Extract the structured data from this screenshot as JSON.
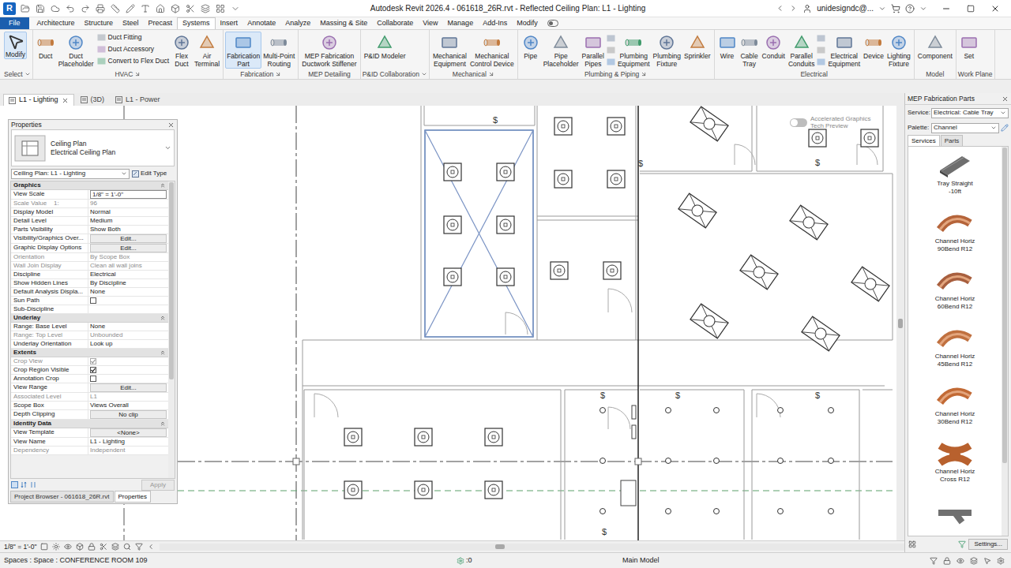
{
  "window": {
    "app_letter": "R",
    "title": "Autodesk Revit 2026.4 - 061618_26R.rvt - Reflected Ceiling Plan: L1 - Lighting",
    "user": "unidesigndc@..."
  },
  "menu_tabs": [
    {
      "label": "File",
      "kind": "app",
      "selected": false
    },
    {
      "label": "Architecture",
      "kind": "tab",
      "selected": false
    },
    {
      "label": "Structure",
      "kind": "tab",
      "selected": false
    },
    {
      "label": "Steel",
      "kind": "tab",
      "selected": false
    },
    {
      "label": "Precast",
      "kind": "tab",
      "selected": false
    },
    {
      "label": "Systems",
      "kind": "tab",
      "selected": true
    },
    {
      "label": "Insert",
      "kind": "tab",
      "selected": false
    },
    {
      "label": "Annotate",
      "kind": "tab",
      "selected": false
    },
    {
      "label": "Analyze",
      "kind": "tab",
      "selected": false
    },
    {
      "label": "Massing & Site",
      "kind": "tab",
      "selected": false
    },
    {
      "label": "Collaborate",
      "kind": "tab",
      "selected": false
    },
    {
      "label": "View",
      "kind": "tab",
      "selected": false
    },
    {
      "label": "Manage",
      "kind": "tab",
      "selected": false
    },
    {
      "label": "Add-Ins",
      "kind": "tab",
      "selected": false
    },
    {
      "label": "Modify",
      "kind": "tab",
      "selected": false
    }
  ],
  "ribbon": {
    "panels": [
      {
        "label": "Select",
        "menu": true,
        "launcher": false,
        "tools": [
          {
            "kind": "large",
            "lines": [
              "Modify"
            ],
            "active": true
          }
        ]
      },
      {
        "label": "HVAC",
        "menu": false,
        "launcher": true,
        "tools": [
          {
            "kind": "large",
            "lines": [
              "Duct"
            ],
            "active": false
          },
          {
            "kind": "large",
            "lines": [
              "Duct",
              "Placeholder"
            ],
            "active": false
          },
          {
            "kind": "stack",
            "items": [
              "Duct Fitting",
              "Duct Accessory",
              "Convert to Flex Duct"
            ]
          },
          {
            "kind": "large",
            "lines": [
              "Flex",
              "Duct"
            ],
            "active": false
          },
          {
            "kind": "large",
            "lines": [
              "Air",
              "Terminal"
            ],
            "active": false
          }
        ]
      },
      {
        "label": "Fabrication",
        "menu": false,
        "launcher": true,
        "tools": [
          {
            "kind": "large",
            "lines": [
              "Fabrication",
              "Part"
            ],
            "active": true
          },
          {
            "kind": "large",
            "lines": [
              "Multi-Point",
              "Routing"
            ],
            "active": false
          }
        ]
      },
      {
        "label": "MEP Detailing",
        "menu": false,
        "launcher": false,
        "tools": [
          {
            "kind": "large",
            "lines": [
              "MEP Fabrication",
              "Ductwork Stiffener"
            ],
            "active": false
          }
        ]
      },
      {
        "label": "P&ID Collaboration",
        "menu": true,
        "launcher": false,
        "tools": [
          {
            "kind": "large",
            "lines": [
              "P&ID Modeler"
            ],
            "active": false
          }
        ]
      },
      {
        "label": "Mechanical",
        "menu": false,
        "launcher": true,
        "tools": [
          {
            "kind": "large",
            "lines": [
              "Mechanical",
              "Equipment"
            ],
            "active": false
          },
          {
            "kind": "large",
            "lines": [
              "Mechanical",
              "Control Device"
            ],
            "active": false
          }
        ]
      },
      {
        "label": "Plumbing & Piping",
        "menu": false,
        "launcher": true,
        "tools": [
          {
            "kind": "large",
            "lines": [
              "Pipe"
            ],
            "active": false
          },
          {
            "kind": "large",
            "lines": [
              "Pipe",
              "Placeholder"
            ],
            "active": false
          },
          {
            "kind": "large",
            "lines": [
              "Parallel",
              "Pipes"
            ],
            "active": false
          },
          {
            "kind": "icons"
          },
          {
            "kind": "large",
            "lines": [
              "Plumbing",
              "Equipment"
            ],
            "active": false
          },
          {
            "kind": "large",
            "lines": [
              "Plumbing",
              "Fixture"
            ],
            "active": false
          },
          {
            "kind": "large",
            "lines": [
              "Sprinkler"
            ],
            "active": false
          }
        ]
      },
      {
        "label": "Electrical",
        "menu": false,
        "launcher": false,
        "tools": [
          {
            "kind": "large",
            "lines": [
              "Wire"
            ],
            "active": false
          },
          {
            "kind": "large",
            "lines": [
              "Cable",
              "Tray"
            ],
            "active": false
          },
          {
            "kind": "large",
            "lines": [
              "Conduit"
            ],
            "active": false
          },
          {
            "kind": "large",
            "lines": [
              "Parallel",
              "Conduits"
            ],
            "active": false
          },
          {
            "kind": "icons"
          },
          {
            "kind": "large",
            "lines": [
              "Electrical",
              "Equipment"
            ],
            "active": false
          },
          {
            "kind": "large",
            "lines": [
              "Device"
            ],
            "active": false
          },
          {
            "kind": "large",
            "lines": [
              "Lighting",
              "Fixture"
            ],
            "active": false
          }
        ]
      },
      {
        "label": "Model",
        "menu": false,
        "launcher": false,
        "tools": [
          {
            "kind": "large",
            "lines": [
              "Component"
            ],
            "active": false
          }
        ]
      },
      {
        "label": "Work Plane",
        "menu": false,
        "launcher": false,
        "tools": [
          {
            "kind": "large",
            "lines": [
              "Set"
            ],
            "active": false
          }
        ]
      }
    ]
  },
  "view_tabs": [
    {
      "label": "L1 - Lighting",
      "selected": true,
      "closable": true
    },
    {
      "label": "(3D)",
      "selected": false,
      "closable": false
    },
    {
      "label": "L1 - Power",
      "selected": false,
      "closable": false
    }
  ],
  "properties": {
    "title": "Properties",
    "type_name": "Ceiling Plan",
    "type_sub": "Electrical Ceiling Plan",
    "selector": "Ceiling Plan: L1 - Lighting",
    "edit_type": "Edit Type",
    "groups": [
      {
        "name": "Graphics",
        "rows": [
          {
            "label": "View Scale",
            "value": "1/8\" = 1'-0\"",
            "kind": "input",
            "disabled": false
          },
          {
            "label": "Scale Value    1:",
            "value": "96",
            "kind": "text",
            "disabled": true
          },
          {
            "label": "Display Model",
            "value": "Normal",
            "kind": "text",
            "disabled": false
          },
          {
            "label": "Detail Level",
            "value": "Medium",
            "kind": "text",
            "disabled": false
          },
          {
            "label": "Parts Visibility",
            "value": "Show Both",
            "kind": "text",
            "disabled": false
          },
          {
            "label": "Visibility/Graphics Over...",
            "value": "Edit...",
            "kind": "button",
            "disabled": false
          },
          {
            "label": "Graphic Display Options",
            "value": "Edit...",
            "kind": "button",
            "disabled": false
          },
          {
            "label": "Orientation",
            "value": "By Scope Box",
            "kind": "text",
            "disabled": true
          },
          {
            "label": "Wall Join Display",
            "value": "Clean all wall joins",
            "kind": "text",
            "disabled": true
          },
          {
            "label": "Discipline",
            "value": "Electrical",
            "kind": "text",
            "disabled": false
          },
          {
            "label": "Show Hidden Lines",
            "value": "By Discipline",
            "kind": "text",
            "disabled": false
          },
          {
            "label": "Default Analysis Displa...",
            "value": "None",
            "kind": "text",
            "disabled": false
          },
          {
            "label": "Sun Path",
            "kind": "check",
            "checked": false,
            "disabled": false
          },
          {
            "label": "Sub-Discipline",
            "kind": "empty",
            "disabled": false
          }
        ]
      },
      {
        "name": "Underlay",
        "rows": [
          {
            "label": "Range: Base Level",
            "value": "None",
            "kind": "text",
            "disabled": false
          },
          {
            "label": "Range: Top Level",
            "value": "Unbounded",
            "kind": "text",
            "disabled": true
          },
          {
            "label": "Underlay Orientation",
            "value": "Look up",
            "kind": "text",
            "disabled": false
          }
        ]
      },
      {
        "name": "Extents",
        "rows": [
          {
            "label": "Crop View",
            "kind": "check",
            "checked": true,
            "disabled": true
          },
          {
            "label": "Crop Region Visible",
            "kind": "check",
            "checked": true,
            "disabled": false
          },
          {
            "label": "Annotation Crop",
            "kind": "check",
            "checked": false,
            "disabled": false
          },
          {
            "label": "View Range",
            "value": "Edit...",
            "kind": "button",
            "disabled": false
          },
          {
            "label": "Associated Level",
            "value": "L1",
            "kind": "text",
            "disabled": true
          },
          {
            "label": "Scope Box",
            "value": "Views Overall",
            "kind": "text",
            "disabled": false
          },
          {
            "label": "Depth Clipping",
            "value": "No clip",
            "kind": "button",
            "disabled": false
          }
        ]
      },
      {
        "name": "Identity Data",
        "rows": [
          {
            "label": "View Template",
            "value": "<None>",
            "kind": "button",
            "disabled": false
          },
          {
            "label": "View Name",
            "value": "L1 - Lighting",
            "kind": "text",
            "disabled": false
          },
          {
            "label": "Dependency",
            "value": "Independent",
            "kind": "text",
            "disabled": true
          }
        ]
      }
    ],
    "apply": "Apply",
    "tabs": [
      {
        "label": "Project Browser - 061618_26R.rvt",
        "selected": false
      },
      {
        "label": "Properties",
        "selected": true
      }
    ]
  },
  "canvas": {
    "switch_symbol": "$",
    "room_selected": true,
    "tech_preview": {
      "lines": [
        "Accelerated Graphics",
        "Tech Preview"
      ],
      "on": false
    }
  },
  "view_control": {
    "scale": "1/8\" = 1'-0\""
  },
  "fabrication_parts": {
    "title": "MEP Fabrication Parts",
    "service_label": "Service:",
    "service": "Electrical: Cable Tray",
    "palette_label": "Palette:",
    "palette": "Channel",
    "tabs": [
      {
        "label": "Services",
        "selected": true
      },
      {
        "label": "Parts",
        "selected": false
      }
    ],
    "items": [
      {
        "lines": [
          "Tray Straight",
          "-10ft"
        ],
        "kind": "straight",
        "color": "#6e6e6e"
      },
      {
        "lines": [
          "Channel Horiz",
          "90Bend R12"
        ],
        "kind": "bend",
        "color": "#b5643a"
      },
      {
        "lines": [
          "Channel Horiz",
          "60Bend R12"
        ],
        "kind": "bend",
        "color": "#a85f3e"
      },
      {
        "lines": [
          "Channel Horiz",
          "45Bend R12"
        ],
        "kind": "bend",
        "color": "#c0703f"
      },
      {
        "lines": [
          "Channel Horiz",
          "30Bend R12"
        ],
        "kind": "bend",
        "color": "#c26a35"
      },
      {
        "lines": [
          "Channel Horiz",
          "Cross R12"
        ],
        "kind": "cross",
        "color": "#b8612e"
      },
      {
        "lines": [],
        "kind": "tee",
        "color": "#707070"
      }
    ],
    "settings": "Settings..."
  },
  "status_bar": {
    "text": "Spaces : Space : CONFERENCE ROOM 109",
    "count": ":0",
    "model": "Main Model"
  }
}
